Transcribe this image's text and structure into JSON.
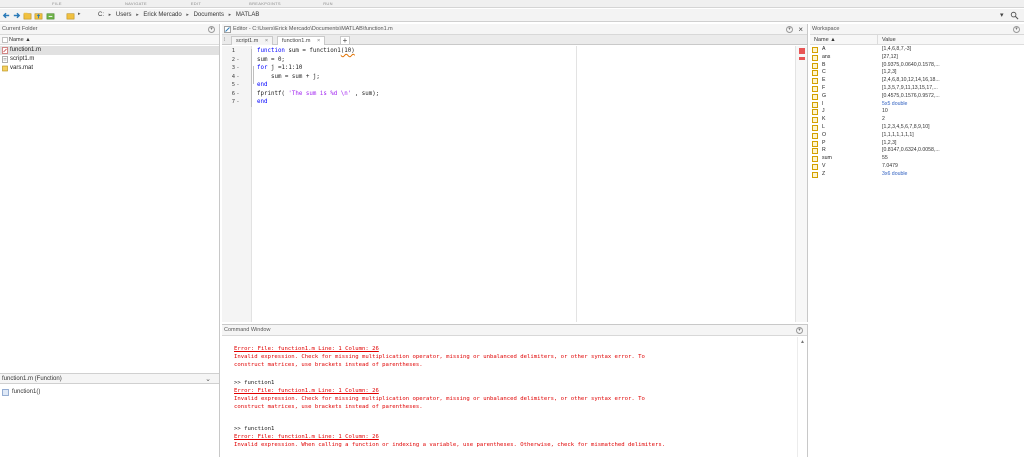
{
  "ribbon": {
    "tabs": [
      "FILE",
      "NAVIGATE",
      "EDIT",
      "BREAKPOINTS",
      "RUN"
    ]
  },
  "address": {
    "crumbs": [
      "C:",
      "Users",
      "Erick Mercado",
      "Documents",
      "MATLAB"
    ],
    "sep": "▸"
  },
  "current_folder": {
    "title": "Current Folder",
    "column": "Name ▲",
    "files": [
      {
        "name": "function1.m",
        "selected": true
      },
      {
        "name": "script1.m",
        "selected": false
      },
      {
        "name": "vars.mat",
        "selected": false
      }
    ],
    "details_title": "function1.m  (Function)",
    "details_item": "function1()"
  },
  "editor": {
    "title": "Editor - C:\\Users\\Erick Mercado\\Documents\\MATLAB\\function1.m",
    "tabs": [
      "script1.m",
      "function1.m"
    ],
    "tab_close": "×",
    "tab_add": "+",
    "close": "×",
    "lines": [
      {
        "n": "1",
        "bp": ""
      },
      {
        "n": "2",
        "bp": "-"
      },
      {
        "n": "3",
        "bp": "-"
      },
      {
        "n": "4",
        "bp": "-"
      },
      {
        "n": "5",
        "bp": "-"
      },
      {
        "n": "6",
        "bp": "-"
      },
      {
        "n": "7",
        "bp": "-"
      }
    ],
    "code": {
      "l1_kw": "function",
      "l1_rest": " sum = function1",
      "l1_err": "(10)",
      "l2": "sum = 0;",
      "l3_kw": "for",
      "l3_rest": " j =1:1:10",
      "l4": "    sum = sum + j;",
      "l5_kw": "end",
      "l6_a": "fprintf( ",
      "l6_str": "'The sum is %d \\n'",
      "l6_b": " , sum);",
      "l7_kw": "end"
    }
  },
  "command_window": {
    "title": "Command Window",
    "block1": {
      "err_line": "Error: File: function1.m Line: 1 Column: 26",
      "msg1": "Invalid expression. Check for missing multiplication operator, missing or unbalanced delimiters, or other syntax error. To",
      "msg2": "construct matrices, use brackets instead of parentheses."
    },
    "block2": {
      "prompt": ">> function1",
      "err_line": "Error: File: function1.m Line: 1 Column: 26",
      "msg1": "Invalid expression. Check for missing multiplication operator, missing or unbalanced delimiters, or other syntax error. To",
      "msg2": "construct matrices, use brackets instead of parentheses."
    },
    "block3": {
      "prompt": ">> function1",
      "err_line": "Error: File: function1.m Line: 1 Column: 26",
      "msg1": "Invalid expression. When calling a function or indexing a variable, use parentheses. Otherwise, check for mismatched delimiters."
    }
  },
  "workspace": {
    "title": "Workspace",
    "col_name": "Name ▲",
    "col_value": "Value",
    "vars": [
      {
        "name": "A",
        "value": "[1,4,6,8,7,-3]"
      },
      {
        "name": "ans",
        "value": "[27,12]"
      },
      {
        "name": "B",
        "value": "[0.9375,0.0640,0.1578,..."
      },
      {
        "name": "C",
        "value": "[1,2,3]"
      },
      {
        "name": "E",
        "value": "[2,4,6,8,10,12,14,16,18..."
      },
      {
        "name": "F",
        "value": "[1,3,5,7,9,11,13,15,17,..."
      },
      {
        "name": "G",
        "value": "[0.4575,0.1576,0.9572,..."
      },
      {
        "name": "I",
        "value": "5x5 double"
      },
      {
        "name": "J",
        "value": "10"
      },
      {
        "name": "K",
        "value": "2"
      },
      {
        "name": "L",
        "value": "[1,2,3,4,5,6,7,8,9,10]"
      },
      {
        "name": "O",
        "value": "[1,1,1,1,1,1,1]"
      },
      {
        "name": "P",
        "value": "[1,2,3]"
      },
      {
        "name": "R",
        "value": "[0.8147,0.6324,0.0058,..."
      },
      {
        "name": "sum",
        "value": "55"
      },
      {
        "name": "V",
        "value": "7.0479"
      },
      {
        "name": "Z",
        "value": "3x6 double"
      }
    ]
  },
  "colors": {
    "keyword": "#0000ff",
    "string": "#a020f0",
    "error": "#e00000"
  },
  "icons": [
    "back-icon",
    "forward-icon",
    "up-folder-icon",
    "browse-folder-icon",
    "search-icon",
    "chevron-down-icon",
    "close-icon",
    "panel-menu-icon"
  ]
}
